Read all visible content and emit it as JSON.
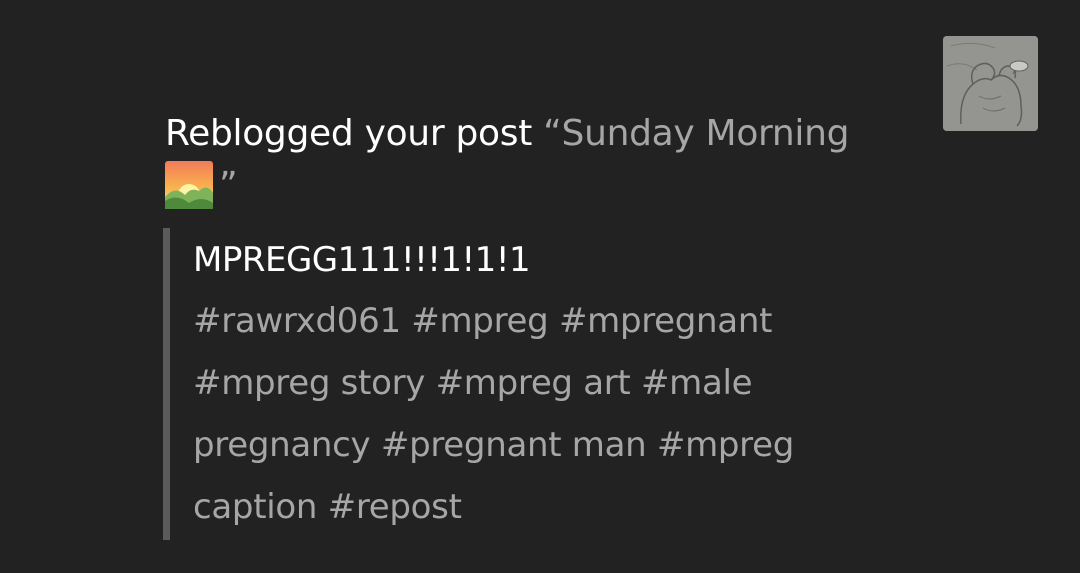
{
  "notification": {
    "action_text": "Reblogged your post ",
    "open_quote": "“",
    "post_title": "Sunday Morning",
    "close_quote": "”",
    "title_emoji": "sunrise-over-mountains-emoji",
    "avatar_icon": "sketch-illustration-avatar",
    "quoted_post": {
      "body": "MPREGG111!!!1!1!1",
      "tags": [
        "#rawrxd061",
        "#mpreg",
        "#mpregnant",
        "#mpreg story",
        "#mpreg art",
        "#male pregnancy",
        "#pregnant man",
        "#mpreg caption",
        "#repost"
      ]
    }
  },
  "colors": {
    "background": "#222222",
    "primary_text": "#ffffff",
    "secondary_text": "#a6a6a6",
    "quote_bar": "#5b5b5b"
  }
}
